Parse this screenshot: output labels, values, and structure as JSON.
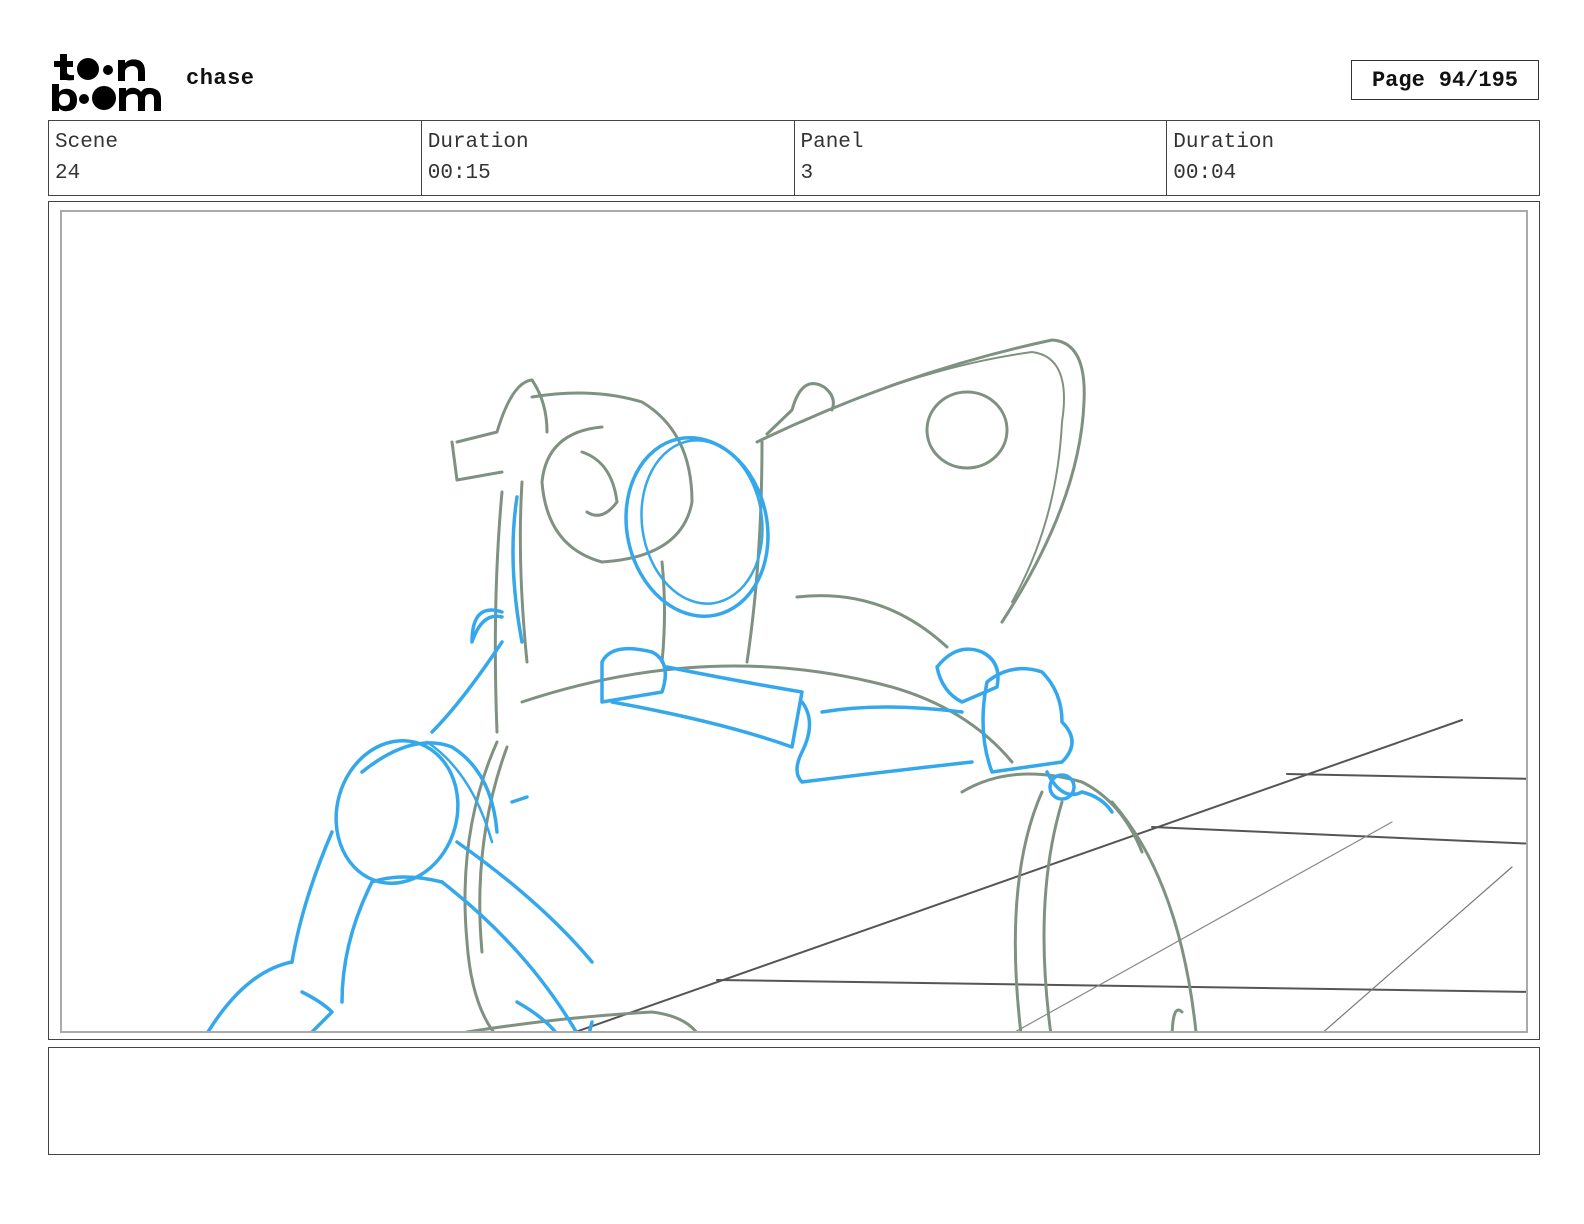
{
  "header": {
    "logo_alt": "toon boom",
    "project": "chase",
    "page_label": "Page",
    "page_value": "94/195"
  },
  "info": {
    "scene_label": "Scene",
    "scene_value": "24",
    "scene_duration_label": "Duration",
    "scene_duration_value": "00:15",
    "panel_label": "Panel",
    "panel_value": "3",
    "panel_duration_label": "Duration",
    "panel_duration_value": "00:04"
  },
  "notes": {
    "text": ""
  },
  "colors": {
    "sketch_green": "#7f9282",
    "sketch_blue": "#35a8ec",
    "floor_lines": "#555555"
  }
}
